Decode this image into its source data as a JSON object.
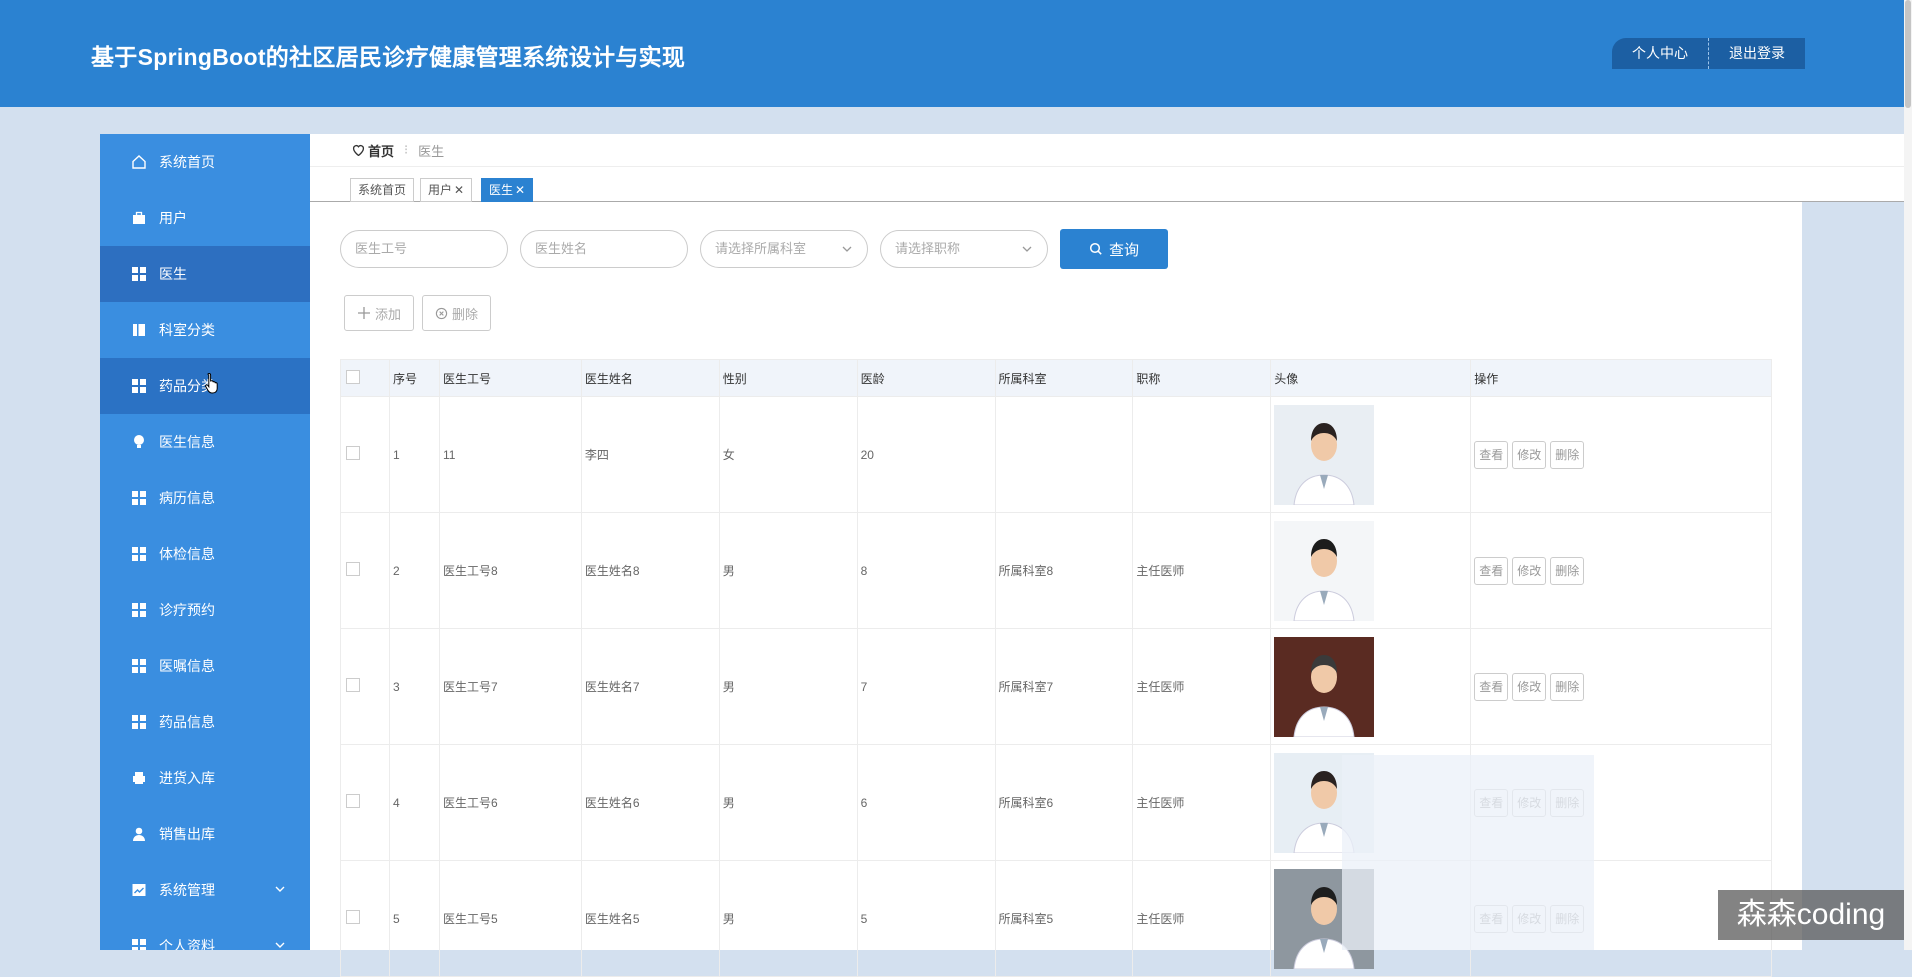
{
  "header": {
    "title": "基于SpringBoot的社区居民诊疗健康管理系统设计与实现",
    "personal_center": "个人中心",
    "logout": "退出登录"
  },
  "sidebar": {
    "items": [
      {
        "label": "系统首页",
        "icon": "home-icon"
      },
      {
        "label": "用户",
        "icon": "briefcase-icon"
      },
      {
        "label": "医生",
        "icon": "grid-icon",
        "active": true
      },
      {
        "label": "科室分类",
        "icon": "book-icon"
      },
      {
        "label": "药品分类",
        "icon": "grid-icon",
        "hover": true
      },
      {
        "label": "医生信息",
        "icon": "bulb-icon"
      },
      {
        "label": "病历信息",
        "icon": "grid-icon"
      },
      {
        "label": "体检信息",
        "icon": "grid-icon"
      },
      {
        "label": "诊疗预约",
        "icon": "grid-icon"
      },
      {
        "label": "医嘱信息",
        "icon": "grid-icon"
      },
      {
        "label": "药品信息",
        "icon": "grid-icon"
      },
      {
        "label": "进货入库",
        "icon": "printer-icon"
      },
      {
        "label": "销售出库",
        "icon": "user-icon"
      },
      {
        "label": "系统管理",
        "icon": "chart-icon",
        "expandable": true
      },
      {
        "label": "个人资料",
        "icon": "grid-icon",
        "expandable": true
      }
    ]
  },
  "breadcrumb": {
    "home": "首页",
    "current": "医生"
  },
  "tabs": [
    {
      "label": "系统首页",
      "closable": false
    },
    {
      "label": "用户",
      "closable": true
    },
    {
      "label": "医生",
      "closable": true,
      "active": true
    }
  ],
  "search": {
    "doctor_no_placeholder": "医生工号",
    "doctor_name_placeholder": "医生姓名",
    "department_placeholder": "请选择所属科室",
    "title_placeholder": "请选择职称",
    "query_button": "查询"
  },
  "actions": {
    "add": "添加",
    "delete": "删除"
  },
  "table": {
    "columns": [
      "序号",
      "医生工号",
      "医生姓名",
      "性别",
      "医龄",
      "所属科室",
      "职称",
      "头像",
      "操作"
    ],
    "row_actions": [
      "查看",
      "修改",
      "删除"
    ],
    "rows": [
      {
        "no": "1",
        "doctor_no": "11",
        "name": "李四",
        "gender": "女",
        "years": "20",
        "department": "",
        "title": ""
      },
      {
        "no": "2",
        "doctor_no": "医生工号8",
        "name": "医生姓名8",
        "gender": "男",
        "years": "8",
        "department": "所属科室8",
        "title": "主任医师"
      },
      {
        "no": "3",
        "doctor_no": "医生工号7",
        "name": "医生姓名7",
        "gender": "男",
        "years": "7",
        "department": "所属科室7",
        "title": "主任医师"
      },
      {
        "no": "4",
        "doctor_no": "医生工号6",
        "name": "医生姓名6",
        "gender": "男",
        "years": "6",
        "department": "所属科室6",
        "title": "主任医师"
      },
      {
        "no": "5",
        "doctor_no": "医生工号5",
        "name": "医生姓名5",
        "gender": "男",
        "years": "5",
        "department": "所属科室5",
        "title": "主任医师"
      }
    ]
  },
  "watermark": "森森coding",
  "colors": {
    "header": "#2b82d1",
    "sidebar": "#3a8ee0",
    "active": "#2d6fc0",
    "page_bg": "#d3e0ef"
  }
}
